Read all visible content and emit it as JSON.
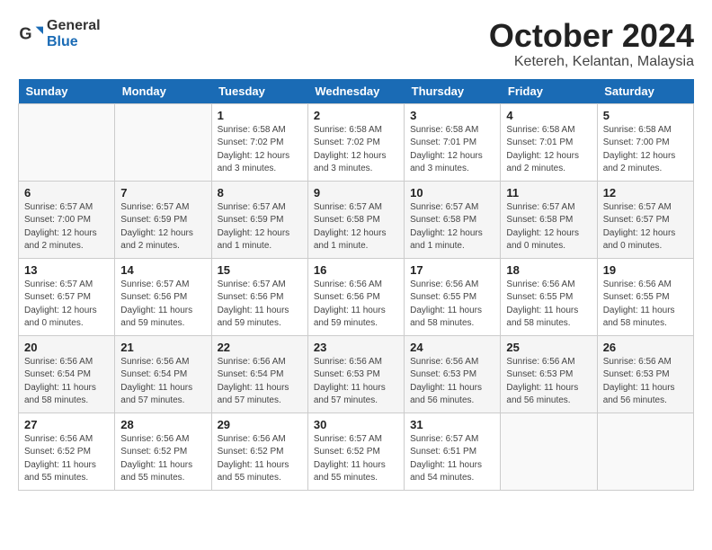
{
  "header": {
    "logo_general": "General",
    "logo_blue": "Blue",
    "title": "October 2024",
    "subtitle": "Ketereh, Kelantan, Malaysia"
  },
  "weekdays": [
    "Sunday",
    "Monday",
    "Tuesday",
    "Wednesday",
    "Thursday",
    "Friday",
    "Saturday"
  ],
  "weeks": [
    [
      {
        "day": "",
        "info": ""
      },
      {
        "day": "",
        "info": ""
      },
      {
        "day": "1",
        "info": "Sunrise: 6:58 AM\nSunset: 7:02 PM\nDaylight: 12 hours and 3 minutes."
      },
      {
        "day": "2",
        "info": "Sunrise: 6:58 AM\nSunset: 7:02 PM\nDaylight: 12 hours and 3 minutes."
      },
      {
        "day": "3",
        "info": "Sunrise: 6:58 AM\nSunset: 7:01 PM\nDaylight: 12 hours and 3 minutes."
      },
      {
        "day": "4",
        "info": "Sunrise: 6:58 AM\nSunset: 7:01 PM\nDaylight: 12 hours and 2 minutes."
      },
      {
        "day": "5",
        "info": "Sunrise: 6:58 AM\nSunset: 7:00 PM\nDaylight: 12 hours and 2 minutes."
      }
    ],
    [
      {
        "day": "6",
        "info": "Sunrise: 6:57 AM\nSunset: 7:00 PM\nDaylight: 12 hours and 2 minutes."
      },
      {
        "day": "7",
        "info": "Sunrise: 6:57 AM\nSunset: 6:59 PM\nDaylight: 12 hours and 2 minutes."
      },
      {
        "day": "8",
        "info": "Sunrise: 6:57 AM\nSunset: 6:59 PM\nDaylight: 12 hours and 1 minute."
      },
      {
        "day": "9",
        "info": "Sunrise: 6:57 AM\nSunset: 6:58 PM\nDaylight: 12 hours and 1 minute."
      },
      {
        "day": "10",
        "info": "Sunrise: 6:57 AM\nSunset: 6:58 PM\nDaylight: 12 hours and 1 minute."
      },
      {
        "day": "11",
        "info": "Sunrise: 6:57 AM\nSunset: 6:58 PM\nDaylight: 12 hours and 0 minutes."
      },
      {
        "day": "12",
        "info": "Sunrise: 6:57 AM\nSunset: 6:57 PM\nDaylight: 12 hours and 0 minutes."
      }
    ],
    [
      {
        "day": "13",
        "info": "Sunrise: 6:57 AM\nSunset: 6:57 PM\nDaylight: 12 hours and 0 minutes."
      },
      {
        "day": "14",
        "info": "Sunrise: 6:57 AM\nSunset: 6:56 PM\nDaylight: 11 hours and 59 minutes."
      },
      {
        "day": "15",
        "info": "Sunrise: 6:57 AM\nSunset: 6:56 PM\nDaylight: 11 hours and 59 minutes."
      },
      {
        "day": "16",
        "info": "Sunrise: 6:56 AM\nSunset: 6:56 PM\nDaylight: 11 hours and 59 minutes."
      },
      {
        "day": "17",
        "info": "Sunrise: 6:56 AM\nSunset: 6:55 PM\nDaylight: 11 hours and 58 minutes."
      },
      {
        "day": "18",
        "info": "Sunrise: 6:56 AM\nSunset: 6:55 PM\nDaylight: 11 hours and 58 minutes."
      },
      {
        "day": "19",
        "info": "Sunrise: 6:56 AM\nSunset: 6:55 PM\nDaylight: 11 hours and 58 minutes."
      }
    ],
    [
      {
        "day": "20",
        "info": "Sunrise: 6:56 AM\nSunset: 6:54 PM\nDaylight: 11 hours and 58 minutes."
      },
      {
        "day": "21",
        "info": "Sunrise: 6:56 AM\nSunset: 6:54 PM\nDaylight: 11 hours and 57 minutes."
      },
      {
        "day": "22",
        "info": "Sunrise: 6:56 AM\nSunset: 6:54 PM\nDaylight: 11 hours and 57 minutes."
      },
      {
        "day": "23",
        "info": "Sunrise: 6:56 AM\nSunset: 6:53 PM\nDaylight: 11 hours and 57 minutes."
      },
      {
        "day": "24",
        "info": "Sunrise: 6:56 AM\nSunset: 6:53 PM\nDaylight: 11 hours and 56 minutes."
      },
      {
        "day": "25",
        "info": "Sunrise: 6:56 AM\nSunset: 6:53 PM\nDaylight: 11 hours and 56 minutes."
      },
      {
        "day": "26",
        "info": "Sunrise: 6:56 AM\nSunset: 6:53 PM\nDaylight: 11 hours and 56 minutes."
      }
    ],
    [
      {
        "day": "27",
        "info": "Sunrise: 6:56 AM\nSunset: 6:52 PM\nDaylight: 11 hours and 55 minutes."
      },
      {
        "day": "28",
        "info": "Sunrise: 6:56 AM\nSunset: 6:52 PM\nDaylight: 11 hours and 55 minutes."
      },
      {
        "day": "29",
        "info": "Sunrise: 6:56 AM\nSunset: 6:52 PM\nDaylight: 11 hours and 55 minutes."
      },
      {
        "day": "30",
        "info": "Sunrise: 6:57 AM\nSunset: 6:52 PM\nDaylight: 11 hours and 55 minutes."
      },
      {
        "day": "31",
        "info": "Sunrise: 6:57 AM\nSunset: 6:51 PM\nDaylight: 11 hours and 54 minutes."
      },
      {
        "day": "",
        "info": ""
      },
      {
        "day": "",
        "info": ""
      }
    ]
  ]
}
